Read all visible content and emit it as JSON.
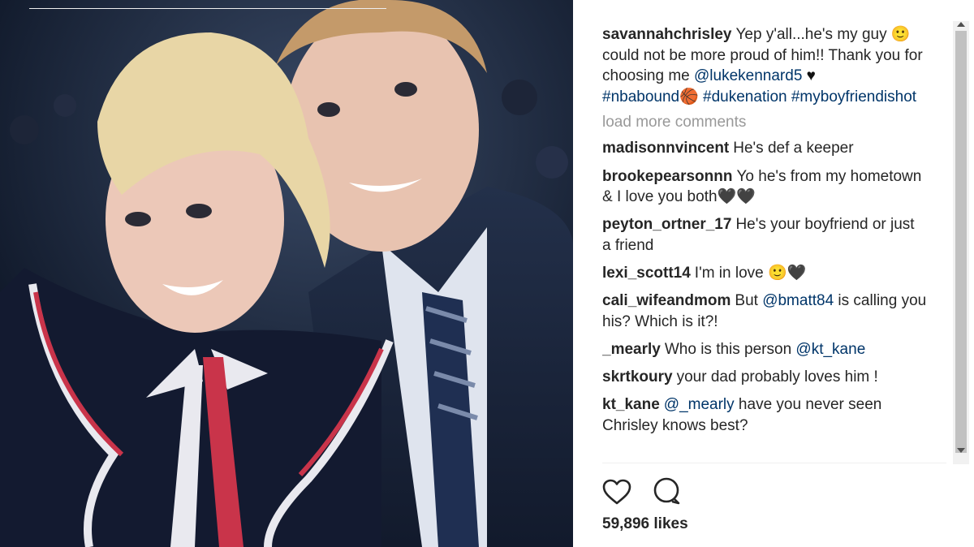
{
  "post": {
    "caption": {
      "username": "savannahchrisley",
      "text_before": "Yep y'all...he's my guy 🙂 could not be more proud of him!! Thank you for choosing me ",
      "mention": "@lukekennard5",
      "text_after": " ♥",
      "hashtags": "#nbabound🏀 #dukenation #myboyfriendishot"
    },
    "load_more_label": "load more comments",
    "comments": [
      {
        "username": "madisonnvincent",
        "text": "He's def a keeper",
        "mention": "",
        "text_after": ""
      },
      {
        "username": "brookepearsonnn",
        "text": "Yo he's from my hometown & I love you both🖤🖤",
        "mention": "",
        "text_after": ""
      },
      {
        "username": "peyton_ortner_17",
        "text": "He's your boyfriend or just a friend",
        "mention": "",
        "text_after": ""
      },
      {
        "username": "lexi_scott14",
        "text": "I'm in love 🙂🖤",
        "mention": "",
        "text_after": ""
      },
      {
        "username": "cali_wifeandmom",
        "text": "But ",
        "mention": "@bmatt84",
        "text_after": " is calling you his? Which is it?!"
      },
      {
        "username": "_mearly",
        "text": "Who is this person ",
        "mention": "@kt_kane",
        "text_after": ""
      },
      {
        "username": "skrtkoury",
        "text": "your dad probably loves him !",
        "mention": "",
        "text_after": ""
      },
      {
        "username": "kt_kane",
        "text": "",
        "mention": "@_mearly",
        "text_after": " have you never seen Chrisley knows best?"
      }
    ],
    "likes": "59,896 likes",
    "icons": {
      "like": "heart-outline-icon",
      "comment": "comment-bubble-icon"
    },
    "colors": {
      "text": "#262626",
      "mention": "#003569",
      "muted": "#999999"
    }
  }
}
